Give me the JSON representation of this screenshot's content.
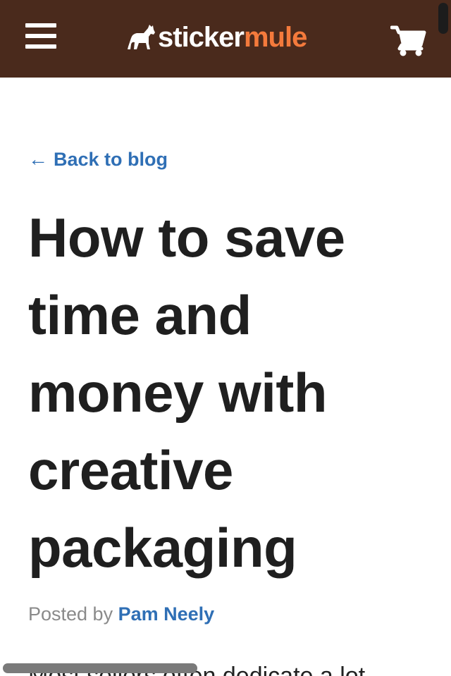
{
  "header": {
    "menu_icon": "hamburger-icon",
    "logo": {
      "part1": "sticker",
      "part2": "mule",
      "icon": "mule-icon"
    },
    "cart_icon": "cart-icon",
    "colors": {
      "bar": "#4a2a1c",
      "logo_accent": "#f47a3c"
    }
  },
  "nav": {
    "back_link_arrow": "←",
    "back_link_label": "Back to blog"
  },
  "article": {
    "title": "How to save time and money with creative packaging",
    "byline_prefix": "Posted by",
    "author": "Pam Neely",
    "first_line_partial": "Most sellers often dedicate a lot"
  },
  "colors": {
    "link": "#2f6fb5",
    "title": "#1f1f1f",
    "muted": "#8a8a8a"
  }
}
